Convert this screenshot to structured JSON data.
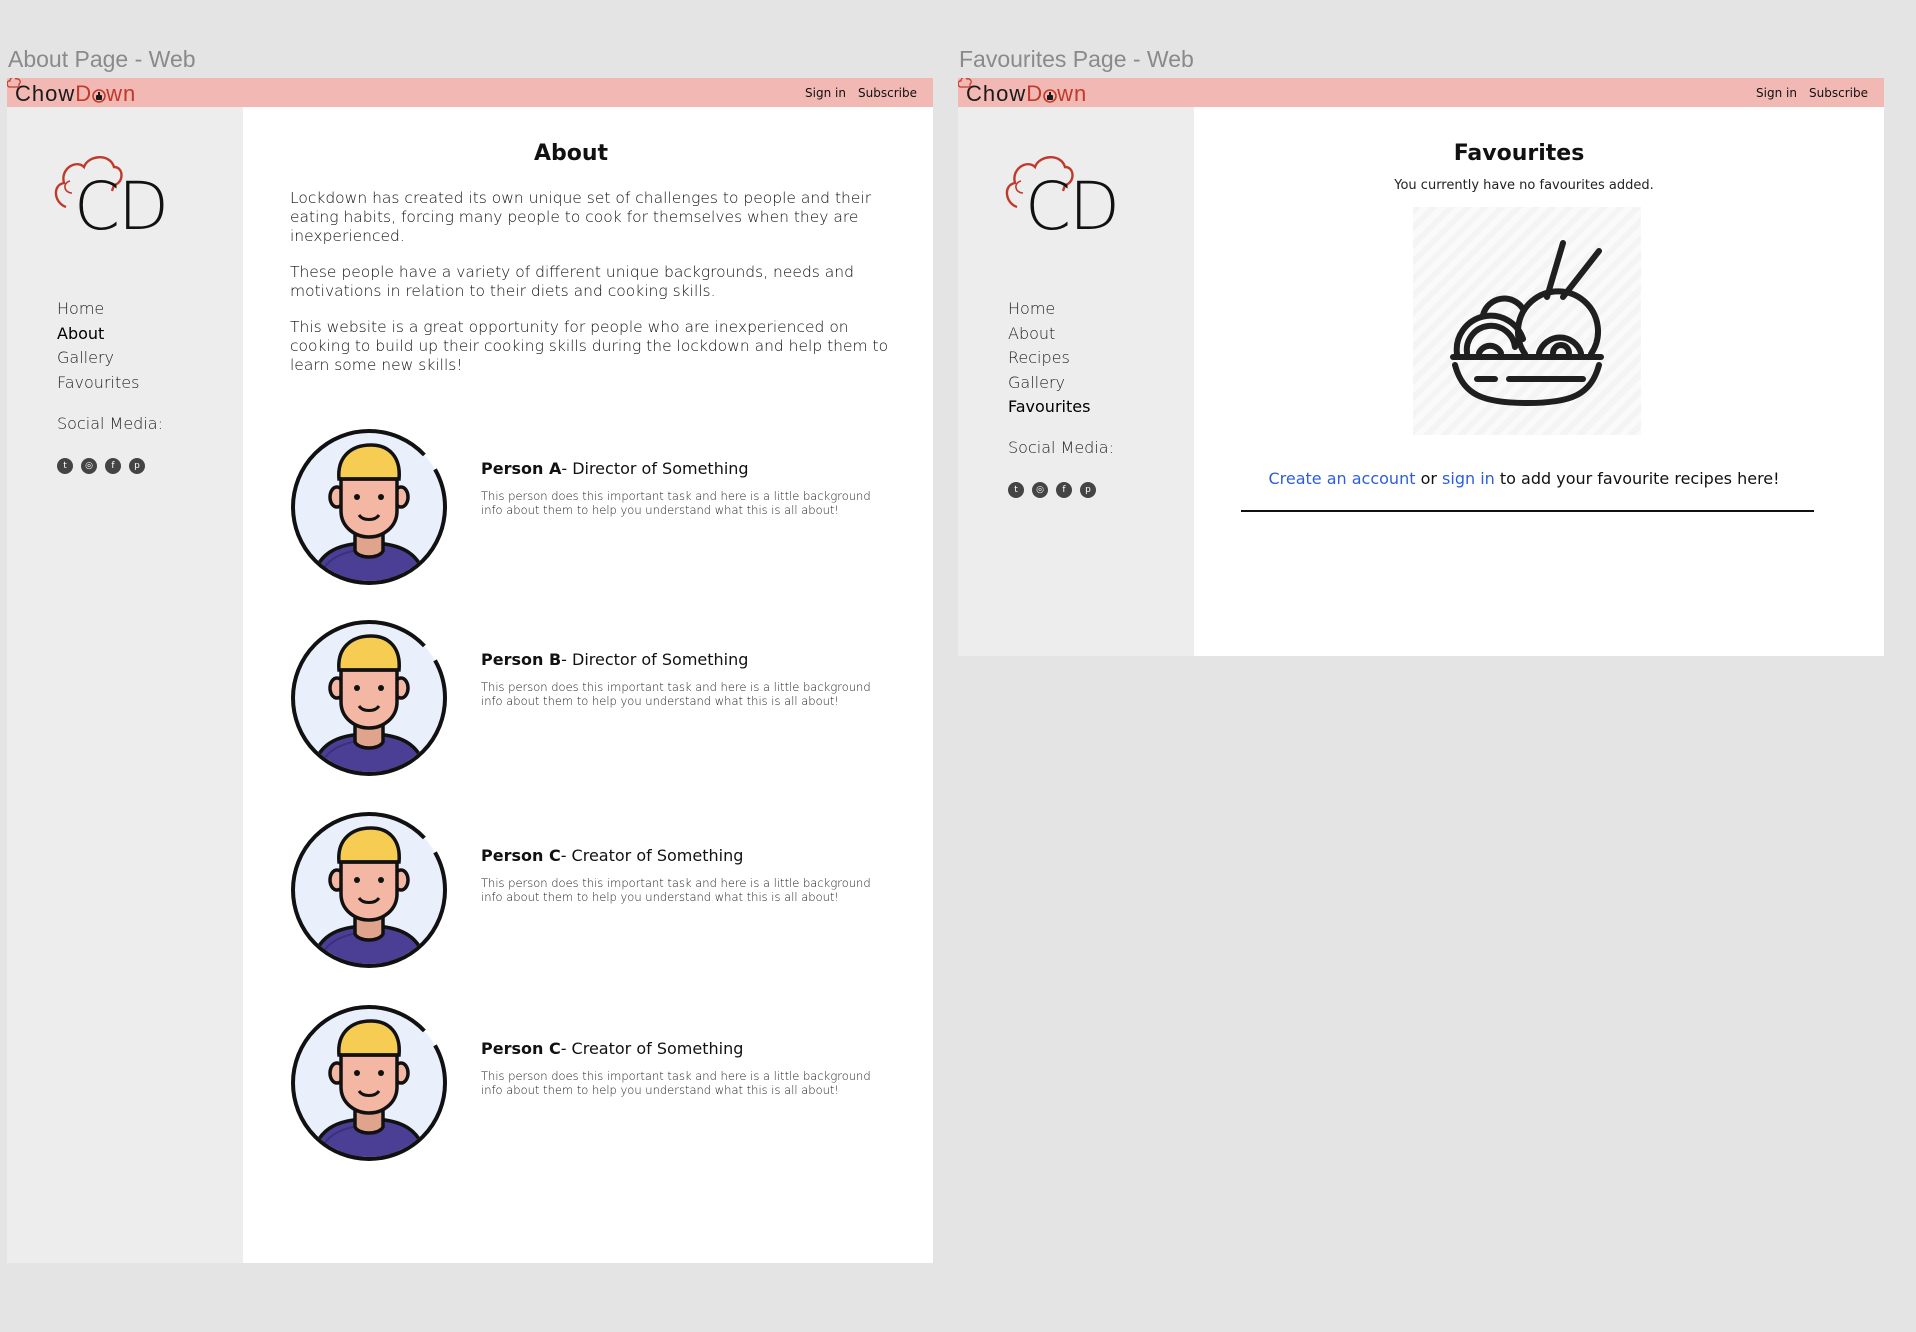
{
  "canvas": {
    "background": "#e4e4e4"
  },
  "frames": {
    "about_title": "About Page - Web",
    "favourites_title": "Favourites Page - Web"
  },
  "brand": {
    "part1": "Chow",
    "part2a": "D",
    "part2b": "wn",
    "accent": "#c0392b",
    "topbar_color": "#f2b8b4"
  },
  "header": {
    "sign_in": "Sign in",
    "subscribe": "Subscribe"
  },
  "logo": {
    "text": "CD"
  },
  "sidebar": {
    "social_label": "Social Media:",
    "social_icons": [
      "twitter-icon",
      "instagram-icon",
      "facebook-icon",
      "pinterest-icon"
    ]
  },
  "about_page": {
    "nav": [
      "Home",
      "About",
      "Gallery",
      "Favourites"
    ],
    "active": "About",
    "heading": "About",
    "paragraphs": [
      "Lockdown has created its own unique set of challenges to people and their eating habits, forcing many people to cook for themselves when they are inexperienced.",
      "These people have a variety of different unique backgrounds, needs and motivations in relation to their diets and cooking skills.",
      "This website is a great opportunity for people who are inexperienced on cooking to build up their cooking skills during the lockdown and help them to learn some new skills!"
    ],
    "people": [
      {
        "name": "Person A",
        "role": "- Director of Something",
        "desc": "This person does this important task and here is a little background info about them to help you understand what this is all about!"
      },
      {
        "name": "Person B",
        "role": "- Director of Something",
        "desc": "This person does this important task and here is a little background info about them to help you understand what this is all about!"
      },
      {
        "name": "Person C",
        "role": "- Creator of Something",
        "desc": "This person does this important task and here is a little background info about them to help you understand what this is all about!"
      },
      {
        "name": "Person C",
        "role": "- Creator of Something",
        "desc": "This person does this important task and here is a little background info about them to help you understand what this is all about!"
      }
    ]
  },
  "favourites_page": {
    "nav": [
      "Home",
      "About",
      "Recipes",
      "Gallery",
      "Favourites"
    ],
    "active": "Favourites",
    "heading": "Favourites",
    "empty_message": "You currently have no favourites added.",
    "cta": {
      "link1": "Create an account",
      "mid": " or ",
      "link2": "sign in",
      "tail": " to add your favourite recipes here!"
    },
    "link_color": "#2b5fd9"
  }
}
